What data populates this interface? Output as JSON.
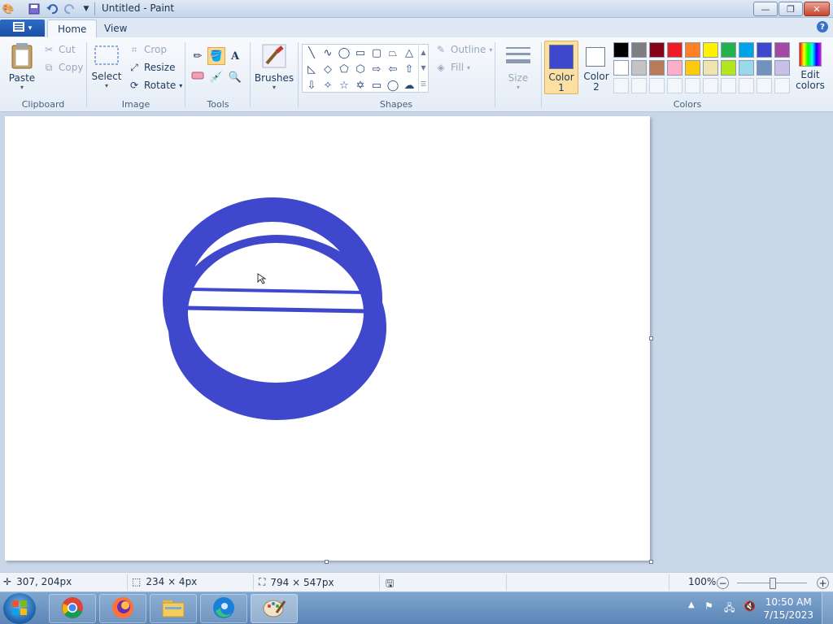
{
  "window": {
    "title": "Untitled - Paint",
    "controls": {
      "minimize": "—",
      "maximize": "❐",
      "close": "✕"
    }
  },
  "tabs": {
    "file": "▾",
    "home": "Home",
    "view": "View",
    "help": "?"
  },
  "ribbon": {
    "clipboard": {
      "label": "Clipboard",
      "paste": "Paste",
      "cut": "Cut",
      "copy": "Copy"
    },
    "image": {
      "label": "Image",
      "select": "Select",
      "crop": "Crop",
      "resize": "Resize",
      "rotate": "Rotate"
    },
    "tools": {
      "label": "Tools"
    },
    "brushes": {
      "label": "Brushes"
    },
    "shapes": {
      "label": "Shapes",
      "outline": "Outline",
      "fill": "Fill"
    },
    "size": {
      "label": "Size"
    },
    "colors": {
      "label": "Colors",
      "color1_line1": "Color",
      "color1_line2": "1",
      "color2_line1": "Color",
      "color2_line2": "2",
      "edit_line1": "Edit",
      "edit_line2": "colors",
      "color1_value": "#3f48cc",
      "color2_value": "#ffffff",
      "palette_row1": [
        "#000000",
        "#7f7f7f",
        "#880015",
        "#ed1c24",
        "#ff7f27",
        "#fff200",
        "#22b14c",
        "#00a2e8",
        "#3f48cc",
        "#a349a4"
      ],
      "palette_row2": [
        "#ffffff",
        "#c3c3c3",
        "#b97a57",
        "#ffaec9",
        "#ffc90e",
        "#efe4b0",
        "#b5e61d",
        "#99d9ea",
        "#7092be",
        "#c8bfe7"
      ]
    }
  },
  "statusbar": {
    "cursor_pos": "307, 204px",
    "selection_size": "234 × 4px",
    "canvas_size": "794 × 547px",
    "zoom": "100%"
  },
  "taskbar": {
    "time": "10:50 AM",
    "date": "7/15/2023"
  }
}
